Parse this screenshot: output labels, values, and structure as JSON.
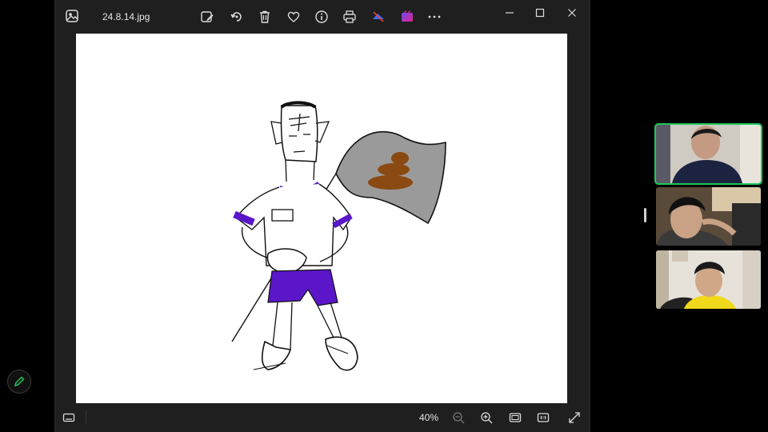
{
  "window": {
    "file_name": "24.8.14.jpg",
    "toolbar_icons": [
      "edit-image-icon",
      "rotate-icon",
      "delete-icon",
      "favorite-icon",
      "info-icon",
      "print-icon",
      "mute-icon",
      "clipchamp-icon",
      "more-icon"
    ],
    "controls": [
      "minimize-icon",
      "maximize-icon",
      "close-icon"
    ]
  },
  "statusbar": {
    "zoom": "40%",
    "icons": [
      "filmstrip-icon",
      "zoom-out-icon",
      "zoom-in-icon",
      "fit-to-window-icon",
      "actual-size-icon",
      "fullscreen-icon"
    ]
  },
  "drawing": {
    "description_colors": {
      "purple": "#5a16c8",
      "poop": "#8a4a12",
      "flag": "#9a9a9a"
    }
  },
  "call": {
    "participants": 3,
    "active_color": "#1fc75b"
  },
  "edit_button_color": "#22c55e"
}
